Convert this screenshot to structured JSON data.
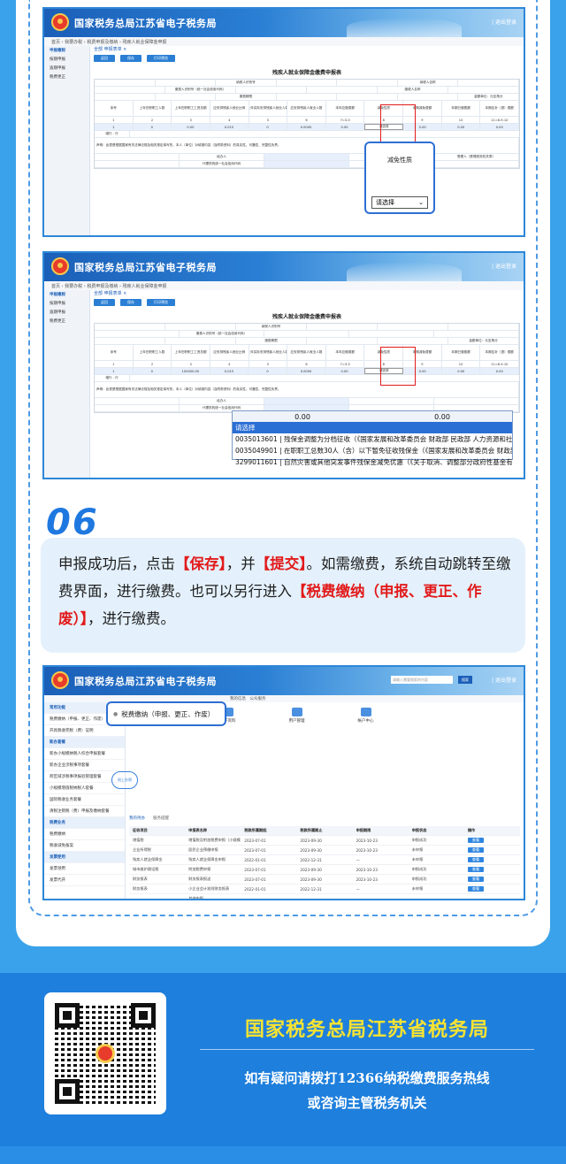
{
  "app": {
    "title": "国家税务总局江苏省电子税务局",
    "user_label": "| 退出登录"
  },
  "shot1": {
    "breadcrumb": "首页 › 我要办税 › 税费申报及缴纳 › 残疾人就业保障金申报",
    "sidebar": [
      "申报缴税",
      "按期申报",
      "逾期申报",
      "税费更正"
    ],
    "tabs": "全部  申报表单 ×",
    "buttons": [
      "返回",
      "保存",
      "打印预览"
    ],
    "form_title": "残疾人就业保障金缴费申报表",
    "fields": [
      "纳税人识别号",
      "纳税人名称",
      "缴费人识别号（统一社会信用代码）",
      "缴费人名称",
      "缴费期限",
      "金额单位：元至角分"
    ],
    "header_cols": [
      "序号",
      "上年在职职工人数",
      "上年在职职工工资总额",
      "应安排残疾人就业比例",
      "上年实际安排残疾人就业人数",
      "应安排残疾人就业人数",
      "本年应缴费额",
      "减免性质",
      "本期减免费额",
      "本期已缴费额",
      "本期应补（退）费额"
    ],
    "row_nums": [
      "1",
      "2",
      "3",
      "4",
      "5",
      "6",
      "7=3-5",
      "8",
      "9",
      "10",
      "11=8-9-10"
    ],
    "data_row": [
      "1",
      "0",
      "0.00",
      "0.015",
      "0",
      "0.0000",
      "0.00",
      "请选择",
      "0.00",
      "0.00",
      "0.00"
    ],
    "add_label": "增行 - 行",
    "declare_text": "声明：此表是根据国家有关法律法规及相关规定填写的，本人（单位）对填报内容（及附带资料）的真实性、可靠性、完整性负责。",
    "agent_label": "经办人",
    "agent_code": "代理机构统一社会信用代码",
    "receiver_label": "受理人（受理税务机关章）",
    "callout_title": "减免性质",
    "callout_select": "请选择",
    "chevron": "⌄"
  },
  "shot2": {
    "data_row": [
      "1",
      "0",
      "100000.00",
      "0.015",
      "0",
      "0.0000",
      "0.00",
      "请选择",
      "0.00",
      "0.00",
      "0.00"
    ],
    "dd_values": [
      "0.00",
      "0.00"
    ],
    "dd_select": "请选择",
    "dd_options": [
      "请选择",
      "0035013601 | 残保金调整为分档征收（《国家发展和改革委员会 财政部 民政部 人力资源和社会保",
      "0035049901 | 在职职工总数30人（含）以下暂免征收残保金（《国家发展和改革委员会 财政部 民政",
      "3299011601 | 自然灾害或其他突发事件残保金减免优惠（《关于取消、调整部分政府性基金有关政策"
    ]
  },
  "step": {
    "number": "06",
    "p1": "申报成功后，点击",
    "save": "【保存】",
    "p2": "，并",
    "submit": "【提交】",
    "p3": "。如需缴费，系统自动跳转至缴费界面，进行缴费。也可以另行进入",
    "pay": "【税费缴纳（申报、更正、作废）】",
    "p4": "，进行缴费。"
  },
  "shot3": {
    "search_placeholder": "请输入需要搜索的内容",
    "search_btn": "搜索",
    "nav": [
      "我的信息",
      "公众服务"
    ],
    "sidebar": [
      {
        "t": "常用功能",
        "sec": true
      },
      {
        "t": "税费缴纳（申报、更正、作废）",
        "sec": false
      },
      {
        "t": "开具税收完税（费）证明",
        "sec": false
      },
      {
        "t": "新办套餐",
        "sec": true
      },
      {
        "t": "新办小规模纳税人综合申报套餐",
        "sec": false
      },
      {
        "t": "新办企业涉税事项套餐",
        "sec": false
      },
      {
        "t": "跨区域涉税事项报验管理套餐",
        "sec": false
      },
      {
        "t": "小规模增值税纳税人套餐",
        "sec": false
      },
      {
        "t": "国际税收业务套餐",
        "sec": false
      },
      {
        "t": "清税注销税（费）申报及缴纳套餐",
        "sec": false
      },
      {
        "t": "税费业务",
        "sec": true
      },
      {
        "t": "税费缴纳",
        "sec": false
      },
      {
        "t": "税收减免备案",
        "sec": false
      },
      {
        "t": "发票使用",
        "sec": true
      },
      {
        "t": "发票领用",
        "sec": false
      },
      {
        "t": "发票代开",
        "sec": false
      }
    ],
    "icons": [
      "纳税人信息",
      "电子资料",
      "用户管理",
      "帐户中心"
    ],
    "cloud_label": "网上办税",
    "table_tabs": [
      "我的待办",
      "服务提醒"
    ],
    "table_head": [
      "征收项目",
      "申报表名称",
      "税款所属期起",
      "税款所属期止",
      "申报期限",
      "申报状态",
      "操作"
    ],
    "rows": [
      [
        "增值税",
        "增值税及附加税费申报（小规模纳税人适用）",
        "2023-07-01",
        "2023-09-30",
        "2023-10-23",
        "申报成功",
        "查看"
      ],
      [
        "企业所得税",
        "居民企业预缴申报",
        "2023-07-01",
        "2023-09-30",
        "2023-10-23",
        "未申报",
        "查看"
      ],
      [
        "残疾人就业保障金",
        "残疾人就业保障金申报",
        "2022-01-01",
        "2022-12-31",
        "—",
        "未申报",
        "查看"
      ],
      [
        "城市维护建设税",
        "附加税费申报",
        "2023-07-01",
        "2023-09-30",
        "2023-10-23",
        "申报成功",
        "查看"
      ],
      [
        "财务报表",
        "财务报表报送",
        "2023-07-01",
        "2023-09-30",
        "2023-10-23",
        "申报成功",
        "查看"
      ],
      [
        "财务报表",
        "小企业会计准则财务报表",
        "2022-01-01",
        "2022-12-31",
        "—",
        "未申报",
        "查看"
      ],
      [
        "—",
        "其他申报",
        "",
        "",
        "",
        "",
        ""
      ]
    ],
    "callout": "税费缴纳（申报、更正、作废）"
  },
  "footer": {
    "title": "国家税务总局江苏省税务局",
    "line1": "如有疑问请拨打12366纳税缴费服务热线",
    "line2": "或咨询主管税务机关"
  }
}
